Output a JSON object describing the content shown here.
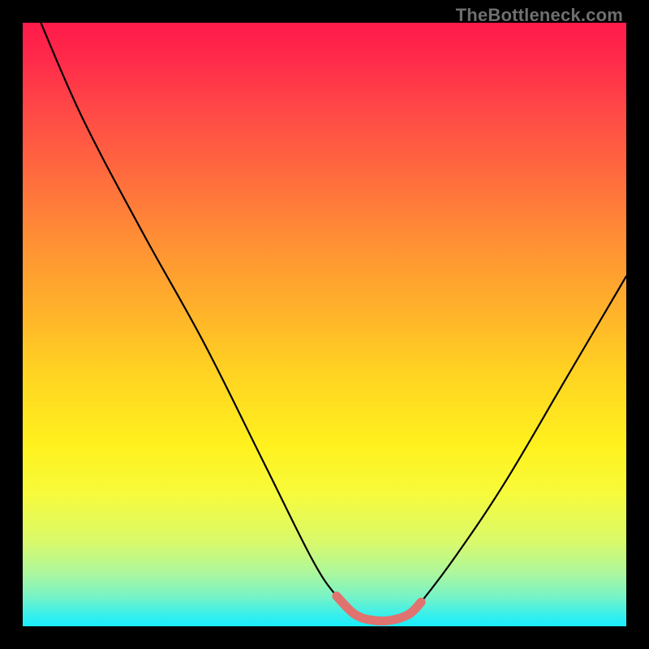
{
  "watermark": {
    "text": "TheBottleneck.com"
  },
  "chart_data": {
    "type": "line",
    "title": "",
    "xlabel": "",
    "ylabel": "",
    "xlim": [
      0,
      100
    ],
    "ylim": [
      0,
      100
    ],
    "grid": false,
    "series": [
      {
        "name": "bottleneck-curve",
        "color": "#000000",
        "x": [
          3,
          10,
          20,
          30,
          40,
          48,
          52,
          55,
          58,
          61,
          64,
          66,
          72,
          80,
          90,
          100
        ],
        "values": [
          100,
          84,
          65,
          47,
          27,
          11,
          5,
          2,
          1,
          1,
          2,
          4,
          12,
          24,
          41,
          58
        ]
      },
      {
        "name": "optimal-region",
        "color": "#e0736f",
        "x": [
          52,
          55,
          58,
          61,
          64,
          66
        ],
        "values": [
          5,
          2,
          1,
          1,
          2,
          4
        ]
      }
    ],
    "annotations": []
  },
  "colors": {
    "background_black": "#000000",
    "gradient_top": "#ff1a4b",
    "gradient_mid": "#fff11e",
    "gradient_bottom": "#18eefc",
    "curve_main": "#000000",
    "curve_highlight": "#e0736f",
    "watermark": "#6f6f6f"
  }
}
